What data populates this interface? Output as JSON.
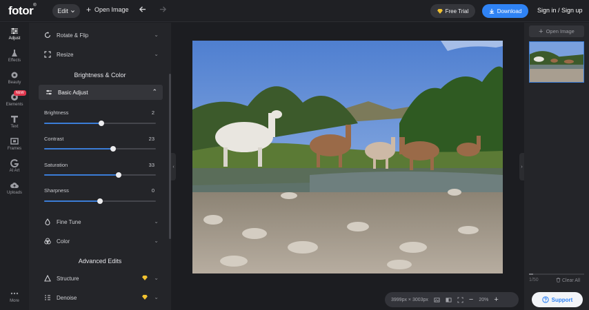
{
  "header": {
    "logo": "fotor",
    "edit_label": "Edit",
    "open_image_label": "Open Image",
    "free_trial_label": "Free Trial",
    "download_label": "Download",
    "signin_label": "Sign in / Sign up"
  },
  "rail": {
    "items": [
      {
        "label": "Adjust",
        "icon": "sliders-icon"
      },
      {
        "label": "Effects",
        "icon": "flask-icon"
      },
      {
        "label": "Beauty",
        "icon": "eye-icon"
      },
      {
        "label": "Elements",
        "icon": "shapes-icon",
        "badge": "NEW"
      },
      {
        "label": "Text",
        "icon": "text-icon"
      },
      {
        "label": "Frames",
        "icon": "frame-icon"
      },
      {
        "label": "AI Art",
        "icon": "ai-art-icon"
      },
      {
        "label": "Uploads",
        "icon": "cloud-upload-icon"
      },
      {
        "label": "More",
        "icon": "more-dots-icon"
      }
    ]
  },
  "panel": {
    "rotate_flip": "Rotate & Flip",
    "resize": "Resize",
    "brightness_color_title": "Brightness & Color",
    "basic_adjust": "Basic Adjust",
    "sliders": [
      {
        "label": "Brightness",
        "value": 2,
        "min": -100,
        "max": 100
      },
      {
        "label": "Contrast",
        "value": 23,
        "min": -100,
        "max": 100
      },
      {
        "label": "Saturation",
        "value": 33,
        "min": -100,
        "max": 100
      },
      {
        "label": "Sharpness",
        "value": 0,
        "min": -100,
        "max": 100
      }
    ],
    "fine_tune": "Fine Tune",
    "color": "Color",
    "advanced_title": "Advanced Edits",
    "structure": "Structure",
    "denoise": "Denoise"
  },
  "canvas": {
    "dimensions": "3999px × 3003px",
    "zoom": "20%"
  },
  "right_panel": {
    "open_image_label": "Open Image",
    "count": "1/50",
    "clear_all": "Clear All",
    "support_label": "Support"
  },
  "colors": {
    "accent": "#2f83f5",
    "slider_fill": "#3b7dd8",
    "badge": "#e0364d",
    "premium": "#f2c230"
  }
}
